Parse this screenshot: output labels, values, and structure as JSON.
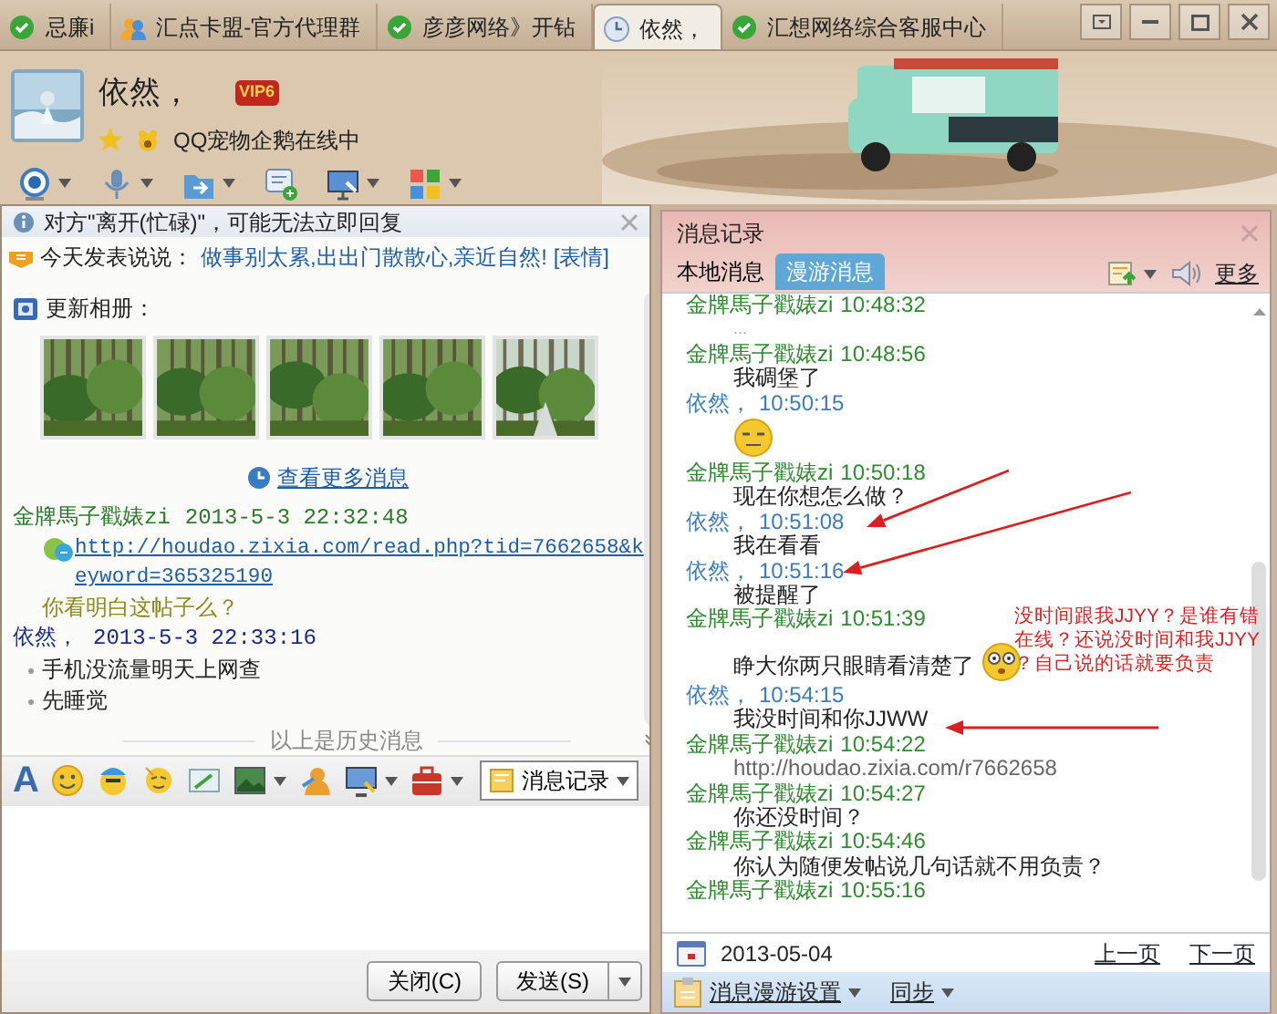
{
  "tabs": [
    {
      "label": "忌廉i",
      "kind": "online",
      "selected": false
    },
    {
      "label": "汇点卡盟-官方代理群",
      "kind": "group",
      "selected": false
    },
    {
      "label": "彦彦网络》开钻",
      "kind": "online",
      "selected": false
    },
    {
      "label": "依然，",
      "kind": "away",
      "selected": true
    },
    {
      "label": "汇想网络综合客服中心",
      "kind": "online",
      "selected": false
    }
  ],
  "contact": {
    "name": "依然，",
    "vip": "VIP6",
    "status_text": "QQ宠物企鹅在线中"
  },
  "chat": {
    "notice": "对方\"离开(忙碌)\"，可能无法立即回复",
    "mood": {
      "label": "今天发表说说：",
      "text": "做事别太累,出出门散散心,亲近自然! [表情]"
    },
    "album": {
      "label": "更新相册："
    },
    "more_link": "查看更多消息",
    "messages": [
      {
        "sender": "金牌馬子戳婊zi",
        "time": "2013-5-3 22:32:48",
        "self": false,
        "lines": [
          {
            "kind": "link",
            "text": "http://houdao.zixia.com/read.php?tid=7662658&keyword=365325190"
          },
          {
            "kind": "text",
            "text": "你看明白这帖子么？"
          }
        ]
      },
      {
        "sender": "依然，",
        "time": "2013-5-3 22:33:16",
        "self": true,
        "lines": [
          {
            "kind": "bullet",
            "text": "手机没流量明天上网查"
          },
          {
            "kind": "bullet",
            "text": "先睡觉"
          }
        ]
      }
    ],
    "history_divider": "以上是历史消息"
  },
  "input_toolbar": {
    "font_key": "A",
    "record_button": "消息记录"
  },
  "buttons": {
    "close": "关闭(C)",
    "send": "发送(S)"
  },
  "history": {
    "title": "消息记录",
    "tabs": [
      {
        "label": "本地消息",
        "selected": false
      },
      {
        "label": "漫游消息",
        "selected": true
      }
    ],
    "more": "更多",
    "entries": [
      {
        "sender": "金牌馬子戳婊zi",
        "time": "10:48:32",
        "self": false,
        "content": [
          {
            "kind": "note",
            "text": "..."
          }
        ]
      },
      {
        "sender": "金牌馬子戳婊zi",
        "time": "10:48:56",
        "self": false,
        "content": [
          {
            "kind": "text",
            "text": "我碉堡了"
          }
        ]
      },
      {
        "sender": "依然，",
        "time": "10:50:15",
        "self": true,
        "content": [
          {
            "kind": "emoji"
          }
        ]
      },
      {
        "sender": "金牌馬子戳婊zi",
        "time": "10:50:18",
        "self": false,
        "content": [
          {
            "kind": "text",
            "text": "现在你想怎么做？"
          }
        ]
      },
      {
        "sender": "依然，",
        "time": "10:51:08",
        "self": true,
        "content": [
          {
            "kind": "text",
            "text": "我在看看"
          }
        ]
      },
      {
        "sender": "依然，",
        "time": "10:51:16",
        "self": true,
        "content": [
          {
            "kind": "text",
            "text": "被提醒了"
          }
        ]
      },
      {
        "sender": "金牌馬子戳婊zi",
        "time": "10:51:39",
        "self": false,
        "content": [
          {
            "kind": "text_emoji",
            "text": "睁大你两只眼睛看清楚了"
          }
        ]
      },
      {
        "sender": "依然，",
        "time": "10:54:15",
        "self": true,
        "content": [
          {
            "kind": "text",
            "text": "我没时间和你JJWW"
          }
        ]
      },
      {
        "sender": "金牌馬子戳婊zi",
        "time": "10:54:22",
        "self": false,
        "content": [
          {
            "kind": "url",
            "text": "http://houdao.zixia.com/r7662658"
          }
        ]
      },
      {
        "sender": "金牌馬子戳婊zi",
        "time": "10:54:27",
        "self": false,
        "content": [
          {
            "kind": "text",
            "text": "你还没时间？"
          }
        ]
      },
      {
        "sender": "金牌馬子戳婊zi",
        "time": "10:54:46",
        "self": false,
        "content": [
          {
            "kind": "text",
            "text": "你认为随便发帖说几句话就不用负责？"
          }
        ]
      },
      {
        "sender": "金牌馬子戳婊zi",
        "time": "10:55:16",
        "self": false
      }
    ],
    "date": "2013-05-04",
    "prev": "上一页",
    "next": "下一页",
    "settings": "消息漫游设置",
    "sync": "同步"
  },
  "annotation": [
    "没时间跟我JJYY？是谁有错",
    "在线？还说没时间和我JJYY",
    "？自己说的话就要负责"
  ]
}
